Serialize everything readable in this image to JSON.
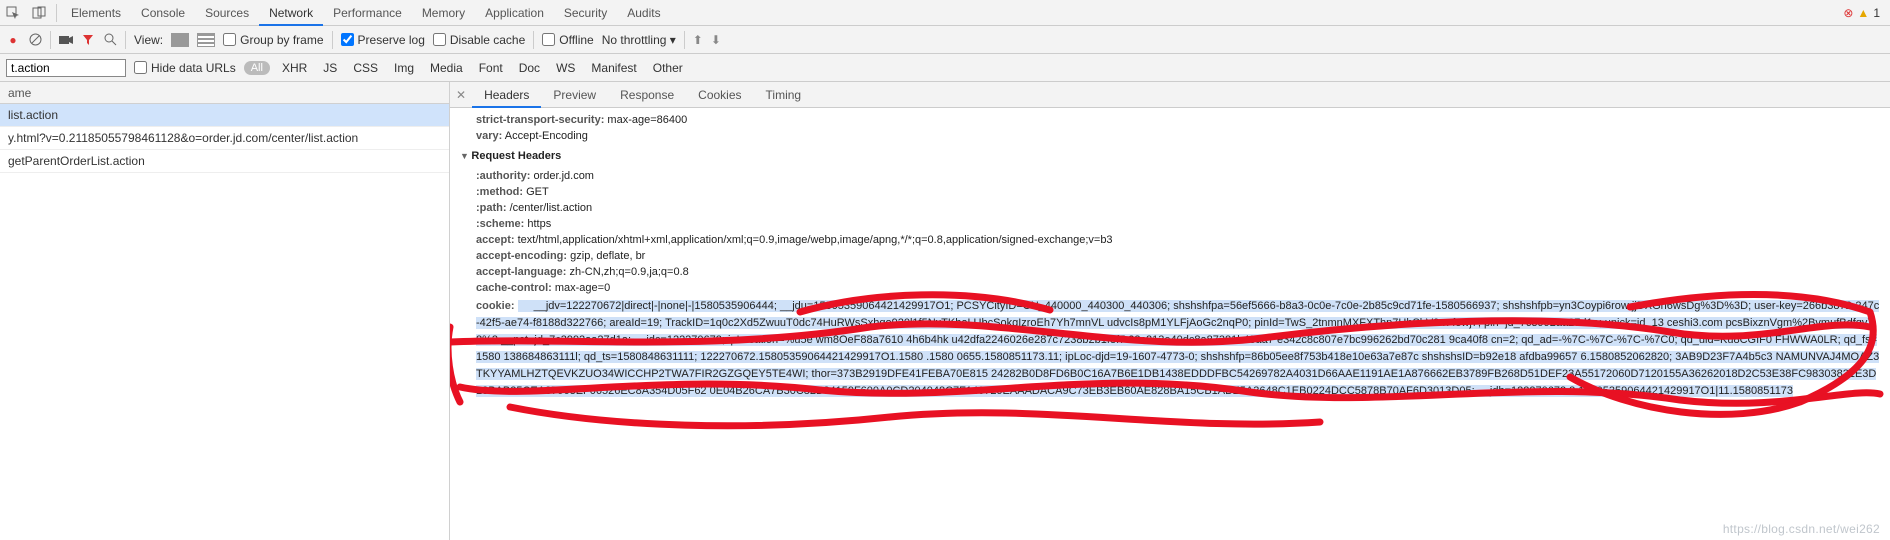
{
  "devtools_tabs": [
    "Elements",
    "Console",
    "Sources",
    "Network",
    "Performance",
    "Memory",
    "Application",
    "Security",
    "Audits"
  ],
  "active_devtools_tab": 3,
  "warning_count": "1",
  "toolbar": {
    "view": "View:",
    "group_by_frame": "Group by frame",
    "preserve_log": "Preserve log",
    "disable_cache": "Disable cache",
    "offline": "Offline",
    "throttle": "No throttling"
  },
  "filter": {
    "value": "t.action",
    "hide_urls": "Hide data URLs",
    "all": "All",
    "types": [
      "XHR",
      "JS",
      "CSS",
      "Img",
      "Media",
      "Font",
      "Doc",
      "WS",
      "Manifest",
      "Other"
    ]
  },
  "left": {
    "header": "ame",
    "rows": [
      "list.action",
      "y.html?v=0.21185055798461128&o=order.jd.com/center/list.action",
      "getParentOrderList.action"
    ],
    "selected": 0
  },
  "subtabs": [
    "Headers",
    "Preview",
    "Response",
    "Cookies",
    "Timing"
  ],
  "active_subtab": 0,
  "response_headers": [
    {
      "k": "strict-transport-security:",
      "v": "max-age=86400"
    },
    {
      "k": "vary:",
      "v": "Accept-Encoding"
    }
  ],
  "section_request": "Request Headers",
  "request_headers": [
    {
      "k": ":authority:",
      "v": "order.jd.com"
    },
    {
      "k": ":method:",
      "v": "GET"
    },
    {
      "k": ":path:",
      "v": "/center/list.action"
    },
    {
      "k": ":scheme:",
      "v": "https"
    },
    {
      "k": "accept:",
      "v": "text/html,application/xhtml+xml,application/xml;q=0.9,image/webp,image/apng,*/*;q=0.8,application/signed-exchange;v=b3"
    },
    {
      "k": "accept-encoding:",
      "v": "gzip, deflate, br"
    },
    {
      "k": "accept-language:",
      "v": "zh-CN,zh;q=0.9,ja;q=0.8"
    },
    {
      "k": "cache-control:",
      "v": "max-age=0"
    }
  ],
  "cookie_key": "cookie:",
  "cookie_value": "__jdv=122270672|direct|-|none|-|1580535906444; __jdu=15805359064421429917O1; PCSYCityID=CN_440000_440300_440306; shshshfpa=56ef5666-b8a3-0c0e-7c0e-2b85c9cd71fe-1580566937; shshshfpb=yn3Coypi6row jjDXGn6wsDg%3D%3D; user-key=266b3872-247c-42f5-ae74-f8188d322766; areaId=19; TrackID=1q0c2Xd5ZwuuT0dc74HuRWsSxhqo920l1f5NxTKhoLUbcSokgIzroEh7Yh7mnVL      udvcIs8pM1YLFjAoGc2nqP0; pinId=TwS_2tnmnMXFXThp7HhSbV9-x-f3wj7; pin=jd_7c3992aa27d1a; unick=jd_13    ceshi3.com pcsBixznVgm%2BvmufBdfqvY8%3  __pst=jd_7c3992aa27d1a; __jdc=122270672; ipLocation=%u5e   wm8OeF88a7610   4h6b4hk  u42dfa2246026e287c7238b2b1f8f7  23c213e40dc8a87381b48aa7  e342c8c807e7bc996262bd70c281  9ca40f8  cn=2; qd_ad=-%7C-%7C-%7C-%7C0; qd_uid=Ku8CGIF0  FHWWA0LR; qd_fs=1580      138684863111l; qd_ts=1580848631111;   122270672.15805359064421429917O1.1580   .1580  0655.1580851173.11; ipLoc-djd=19-1607-4773-0; shshshfp=86b05ee8f753b418e10e63a7e87c     shshshsID=b92e18   afdba99657  6.1580852062820; 3AB9D23F7A4b5c3    NAMUNVAJ4MOAZ3TKYYAMLHZTQEVKZUO34WICCHP2TWA7FIR2GZGQEY5TE4WI; thor=373B2919DFE41FEBA70E815   24282B0D8FD6B0C16A7B6E1DB1438EDDDFBC54269782A4031D66AAE1191AE1A876662EB3789FB268D51DEF23A55172060D7120155A36262018D2C53E38FC98303821E3D13BAB25CEA87963EF06526EC8A354D05F62  0E04B26CA7B30C82B84159F600A0CD204048C7F140729EAAADACA9C73EB3EB60AE828BA15CB1ABE5A3648C1EB0224DCC5878B70AF6D3013D05; __jdb=122270672.8.15805359064421429917O1|11.1580851173",
  "watermark": "https://blog.csdn.net/wei262"
}
